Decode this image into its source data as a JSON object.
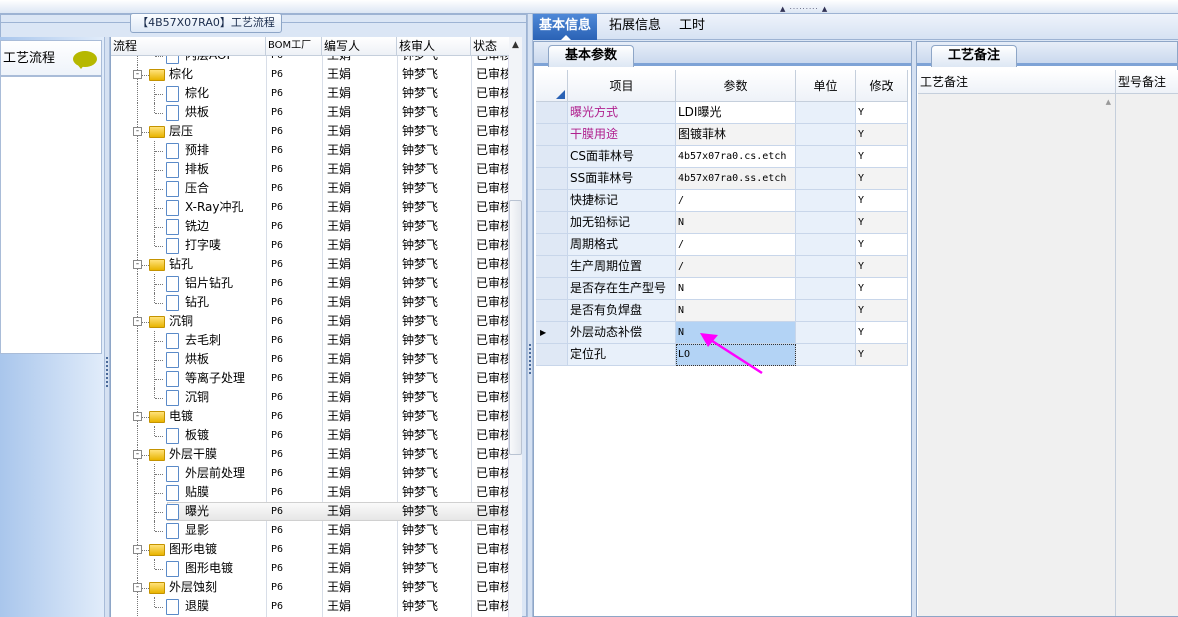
{
  "window": {
    "group_title": "【4B57X07RA0】工艺流程"
  },
  "left_panel": {
    "title": "工艺流程",
    "icon": "speech-bubble-icon"
  },
  "tree": {
    "columns": [
      "流程",
      "BOM工厂",
      "编写人",
      "核审人",
      "状态"
    ],
    "rows": [
      {
        "name": "内层AOI",
        "level": 2,
        "bom": "P6",
        "writer": "王娟",
        "reviewer": "钟梦飞",
        "status": "已审核"
      },
      {
        "name": "棕化",
        "level": 1,
        "bom": "P6",
        "writer": "王娟",
        "reviewer": "钟梦飞",
        "status": "已审核"
      },
      {
        "name": "棕化",
        "level": 2,
        "bom": "P6",
        "writer": "王娟",
        "reviewer": "钟梦飞",
        "status": "已审核"
      },
      {
        "name": "烘板",
        "level": 2,
        "bom": "P6",
        "writer": "王娟",
        "reviewer": "钟梦飞",
        "status": "已审核"
      },
      {
        "name": "层压",
        "level": 1,
        "bom": "P6",
        "writer": "王娟",
        "reviewer": "钟梦飞",
        "status": "已审核"
      },
      {
        "name": "预排",
        "level": 2,
        "bom": "P6",
        "writer": "王娟",
        "reviewer": "钟梦飞",
        "status": "已审核"
      },
      {
        "name": "排板",
        "level": 2,
        "bom": "P6",
        "writer": "王娟",
        "reviewer": "钟梦飞",
        "status": "已审核"
      },
      {
        "name": "压合",
        "level": 2,
        "bom": "P6",
        "writer": "王娟",
        "reviewer": "钟梦飞",
        "status": "已审核"
      },
      {
        "name": "X-Ray冲孔",
        "level": 2,
        "bom": "P6",
        "writer": "王娟",
        "reviewer": "钟梦飞",
        "status": "已审核"
      },
      {
        "name": "铣边",
        "level": 2,
        "bom": "P6",
        "writer": "王娟",
        "reviewer": "钟梦飞",
        "status": "已审核"
      },
      {
        "name": "打字唛",
        "level": 2,
        "bom": "P6",
        "writer": "王娟",
        "reviewer": "钟梦飞",
        "status": "已审核"
      },
      {
        "name": "钻孔",
        "level": 1,
        "bom": "P6",
        "writer": "王娟",
        "reviewer": "钟梦飞",
        "status": "已审核"
      },
      {
        "name": "铝片钻孔",
        "level": 2,
        "bom": "P6",
        "writer": "王娟",
        "reviewer": "钟梦飞",
        "status": "已审核"
      },
      {
        "name": "钻孔",
        "level": 2,
        "bom": "P6",
        "writer": "王娟",
        "reviewer": "钟梦飞",
        "status": "已审核"
      },
      {
        "name": "沉铜",
        "level": 1,
        "bom": "P6",
        "writer": "王娟",
        "reviewer": "钟梦飞",
        "status": "已审核"
      },
      {
        "name": "去毛刺",
        "level": 2,
        "bom": "P6",
        "writer": "王娟",
        "reviewer": "钟梦飞",
        "status": "已审核"
      },
      {
        "name": "烘板",
        "level": 2,
        "bom": "P6",
        "writer": "王娟",
        "reviewer": "钟梦飞",
        "status": "已审核"
      },
      {
        "name": "等离子处理",
        "level": 2,
        "bom": "P6",
        "writer": "王娟",
        "reviewer": "钟梦飞",
        "status": "已审核"
      },
      {
        "name": "沉铜",
        "level": 2,
        "bom": "P6",
        "writer": "王娟",
        "reviewer": "钟梦飞",
        "status": "已审核"
      },
      {
        "name": "电镀",
        "level": 1,
        "bom": "P6",
        "writer": "王娟",
        "reviewer": "钟梦飞",
        "status": "已审核"
      },
      {
        "name": "板镀",
        "level": 2,
        "bom": "P6",
        "writer": "王娟",
        "reviewer": "钟梦飞",
        "status": "已审核"
      },
      {
        "name": "外层干膜",
        "level": 1,
        "bom": "P6",
        "writer": "王娟",
        "reviewer": "钟梦飞",
        "status": "已审核"
      },
      {
        "name": "外层前处理",
        "level": 2,
        "bom": "P6",
        "writer": "王娟",
        "reviewer": "钟梦飞",
        "status": "已审核"
      },
      {
        "name": "贴膜",
        "level": 2,
        "bom": "P6",
        "writer": "王娟",
        "reviewer": "钟梦飞",
        "status": "已审核"
      },
      {
        "name": "曝光",
        "level": 2,
        "selected": true,
        "bom": "P6",
        "writer": "王娟",
        "reviewer": "钟梦飞",
        "status": "已审核"
      },
      {
        "name": "显影",
        "level": 2,
        "bom": "P6",
        "writer": "王娟",
        "reviewer": "钟梦飞",
        "status": "已审核"
      },
      {
        "name": "图形电镀",
        "level": 1,
        "bom": "P6",
        "writer": "王娟",
        "reviewer": "钟梦飞",
        "status": "已审核"
      },
      {
        "name": "图形电镀",
        "level": 2,
        "bom": "P6",
        "writer": "王娟",
        "reviewer": "钟梦飞",
        "status": "已审核"
      },
      {
        "name": "外层蚀刻",
        "level": 1,
        "bom": "P6",
        "writer": "王娟",
        "reviewer": "钟梦飞",
        "status": "已审核"
      },
      {
        "name": "退膜",
        "level": 2,
        "bom": "P6",
        "writer": "王娟",
        "reviewer": "钟梦飞",
        "status": "已审核"
      }
    ]
  },
  "right": {
    "tabs": [
      {
        "label": "基本信息",
        "active": true
      },
      {
        "label": "拓展信息"
      },
      {
        "label": "工时"
      }
    ],
    "params_tab": "基本参数",
    "params_columns": [
      "项目",
      "参数",
      "单位",
      "修改"
    ],
    "params": [
      {
        "item": "曝光方式",
        "value": "LDI曝光",
        "unit": "",
        "modify": "Y",
        "highlight": true
      },
      {
        "item": "干膜用途",
        "value": "图镀菲林",
        "unit": "",
        "modify": "Y",
        "highlight": true
      },
      {
        "item": "CS面菲林号",
        "value": "4b57x07ra0.cs.etch",
        "unit": "",
        "modify": "Y"
      },
      {
        "item": "SS面菲林号",
        "value": "4b57x07ra0.ss.etch",
        "unit": "",
        "modify": "Y"
      },
      {
        "item": "快捷标记",
        "value": "/",
        "unit": "",
        "modify": "Y"
      },
      {
        "item": "加无铅标记",
        "value": "N",
        "unit": "",
        "modify": "Y"
      },
      {
        "item": "周期格式",
        "value": "/",
        "unit": "",
        "modify": "Y"
      },
      {
        "item": "生产周期位置",
        "value": "/",
        "unit": "",
        "modify": "Y"
      },
      {
        "item": "是否存在生产型号",
        "value": "N",
        "unit": "",
        "modify": "Y"
      },
      {
        "item": "是否有负焊盘",
        "value": "N",
        "unit": "",
        "modify": "Y"
      },
      {
        "item": "外层动态补偿",
        "value": "N",
        "unit": "",
        "modify": "Y",
        "current": true
      },
      {
        "item": "定位孔",
        "value": "LO",
        "unit": "",
        "modify": "Y",
        "focused": true
      }
    ],
    "notes_tab": "工艺备注",
    "notes_columns": [
      "工艺备注",
      "型号备注"
    ]
  },
  "colors": {
    "highlight_text": "#b0208e",
    "selected_cell": "#b3d3f5",
    "annotation_arrow": "#ff00ff",
    "active_tab": "#3a72c4"
  }
}
